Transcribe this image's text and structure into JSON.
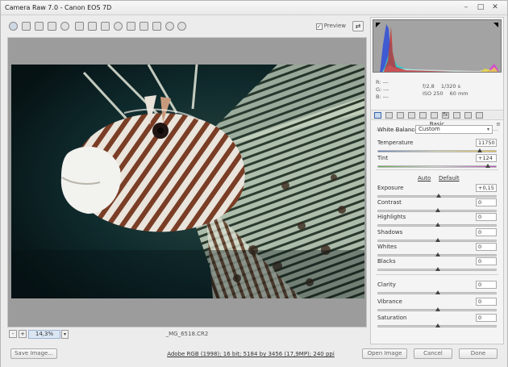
{
  "window": {
    "title": "Camera Raw 7.0  -  Canon EOS 7D",
    "controls": [
      "–",
      "□",
      "✕"
    ]
  },
  "toolbar": {
    "tools": [
      "zoom-icon",
      "hand-icon",
      "white-balance-icon",
      "color-sampler-icon",
      "target-adjust-icon",
      "crop-icon",
      "straighten-icon",
      "spot-removal-icon",
      "red-eye-icon",
      "adjustment-brush-icon",
      "graduated-filter-icon",
      "preferences-icon",
      "rotate-ccw-icon",
      "rotate-cw-icon"
    ],
    "preview_label": "Preview",
    "preview_checked": "✓",
    "fullscreen_glyph": "⇄"
  },
  "status": {
    "zoom_minus": "-",
    "zoom_plus": "+",
    "zoom_value": "14,3%",
    "zoom_dropdown": "▾",
    "filename": "_MG_6518.CR2"
  },
  "bottom": {
    "save_label": "Save Image...",
    "workflow_text": "Adobe RGB (1998); 16 bit; 5184 by 3456 (17,9MP); 240 ppi",
    "open_label": "Open Image",
    "cancel_label": "Cancel",
    "done_label": "Done"
  },
  "readout": {
    "r": "R:    ---",
    "g": "G:    ---",
    "b": "B:    ---",
    "aperture": "f/2,8",
    "shutter": "1/320 s",
    "iso": "ISO 250",
    "focal": "60 mm"
  },
  "panel": {
    "tab_icons": [
      "basic-tab-icon",
      "tone-curve-tab-icon",
      "detail-tab-icon",
      "hsl-tab-icon",
      "split-toning-tab-icon",
      "lens-corrections-tab-icon",
      "effects-tab-icon",
      "camera-calibration-tab-icon",
      "presets-tab-icon",
      "snapshots-tab-icon"
    ],
    "fx_glyph": "fx",
    "section_title": "Basic",
    "section_menu": "≡",
    "white_balance_label": "White Balance:",
    "white_balance_value": "Custom",
    "select_arrow": "▾",
    "auto_label": "Auto",
    "default_label": "Default",
    "sliders_top": [
      {
        "label": "Temperature",
        "value": "11750",
        "level": 0.85
      },
      {
        "label": "Tint",
        "value": "+124",
        "level": 0.92
      }
    ],
    "sliders_tone": [
      {
        "label": "Exposure",
        "value": "+0,15",
        "level": 0.51
      },
      {
        "label": "Contrast",
        "value": "0",
        "level": 0.5
      },
      {
        "label": "Highlights",
        "value": "0",
        "level": 0.5
      },
      {
        "label": "Shadows",
        "value": "0",
        "level": 0.5
      },
      {
        "label": "Whites",
        "value": "0",
        "level": 0.5
      },
      {
        "label": "Blacks",
        "value": "0",
        "level": 0.5
      }
    ],
    "sliders_presence": [
      {
        "label": "Clarity",
        "value": "0",
        "level": 0.5
      },
      {
        "label": "Vibrance",
        "value": "0",
        "level": 0.5
      },
      {
        "label": "Saturation",
        "value": "0",
        "level": 0.5
      }
    ]
  },
  "colors": {
    "accent": "#3a68a8",
    "preview_bg": "#9c9c9c",
    "photo_bg": "#0a1a1d"
  }
}
